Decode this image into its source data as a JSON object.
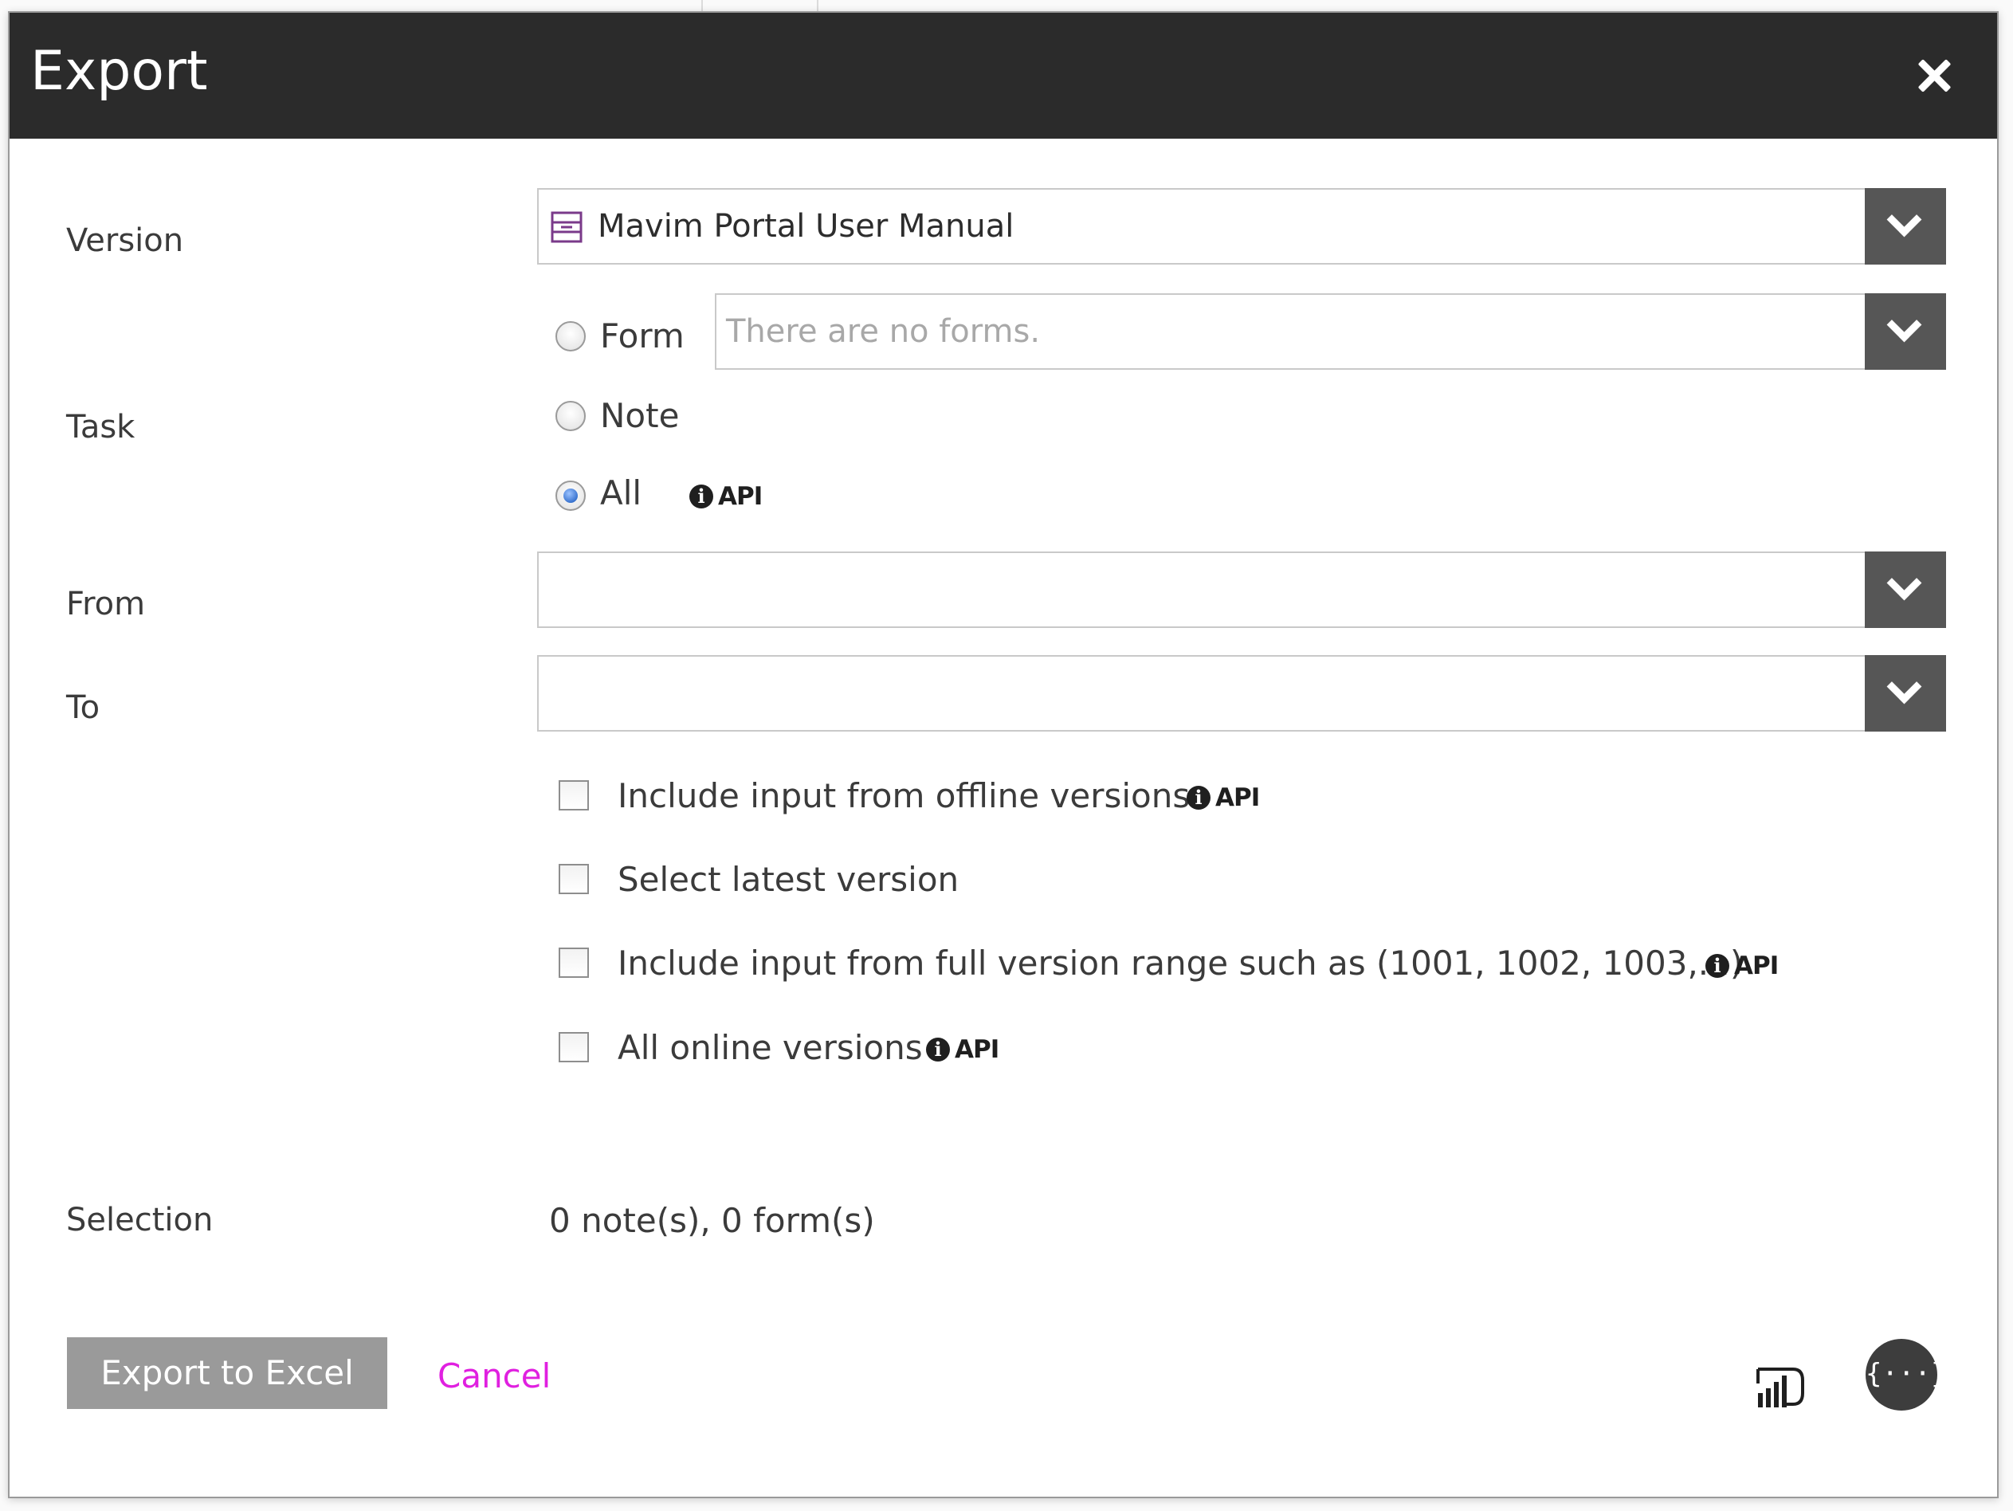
{
  "dialog": {
    "title": "Export",
    "close_icon": "close-icon"
  },
  "version": {
    "label": "Version",
    "selected": "Mavim Portal User Manual",
    "icon": "document-icon"
  },
  "task": {
    "label": "Task",
    "options": [
      {
        "label": "Form",
        "checked": false
      },
      {
        "label": "Note",
        "checked": false
      },
      {
        "label": "All",
        "checked": true
      }
    ],
    "form_placeholder": "There are no forms.",
    "api_label": "API"
  },
  "from": {
    "label": "From",
    "value": ""
  },
  "to": {
    "label": "To",
    "value": ""
  },
  "options": [
    {
      "label": "Include input from offline versions",
      "checked": false,
      "api": "API"
    },
    {
      "label": "Select latest version",
      "checked": false
    },
    {
      "label": "Include input from full version range such as (1001, 1002, 1003,...)",
      "checked": false,
      "api": "API"
    },
    {
      "label": "All online versions",
      "checked": false,
      "api": "API"
    }
  ],
  "selection": {
    "label": "Selection",
    "value": "0 note(s), 0 form(s)"
  },
  "footer": {
    "export_label": "Export to Excel",
    "cancel_label": "Cancel",
    "powerbi_icon": "power-bi-icon",
    "json_icon": "json-braces-icon",
    "json_glyph": "{···}"
  },
  "colors": {
    "titlebar": "#2b2b2b",
    "dropdown_button": "#565656",
    "export_button": "#9a9a9a",
    "cancel_link": "#e020e0",
    "radio_selected": "#3a74d0"
  }
}
